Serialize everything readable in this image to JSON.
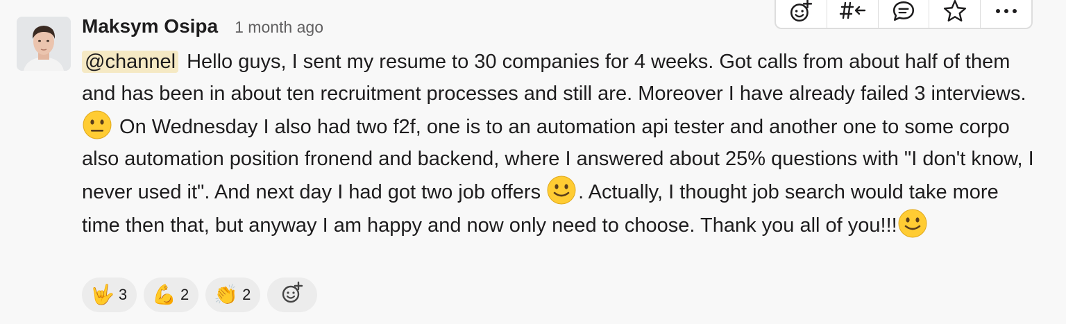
{
  "message": {
    "author": "Maksym Osipa",
    "timestamp": "1 month ago",
    "mention": "@channel",
    "text_1": " Hello guys, I sent my resume to 30 companies for 4 weeks. Got calls from about half of them and has been in about ten recruitment processes and still are. Moreover I have already failed 3 interviews. ",
    "emoji_1": "neutral-face",
    "text_2": " On Wednesday I also had two f2f, one is to an automation api tester and another one to some corpo also automation position fronend and backend, where I answered about 25% questions with \"I don't know, I never used it\". And next day I had got two job offers ",
    "emoji_2": "slightly-smiling-face",
    "text_3": ". Actually, I thought job search would take more time then that, but anyway I am happy and now only need to choose. Thank you all of you!!!",
    "emoji_3": "slightly-smiling-face"
  },
  "reactions": [
    {
      "emoji": "🤟",
      "icon": "love-you-gesture",
      "count": "3"
    },
    {
      "emoji": "💪",
      "icon": "flexed-biceps",
      "count": "2"
    },
    {
      "emoji": "👏",
      "icon": "clapping-hands",
      "count": "2"
    }
  ],
  "toolbar": {
    "icons": [
      "add-reaction-icon",
      "reply-in-channel-icon",
      "reply-in-thread-icon",
      "star-icon",
      "more-actions-icon"
    ]
  },
  "colors": {
    "background": "#f8f8f8",
    "mention_highlight": "#f5e9c4",
    "reaction_pill": "#ececec",
    "emoji_yellow": "#ffcc33"
  }
}
